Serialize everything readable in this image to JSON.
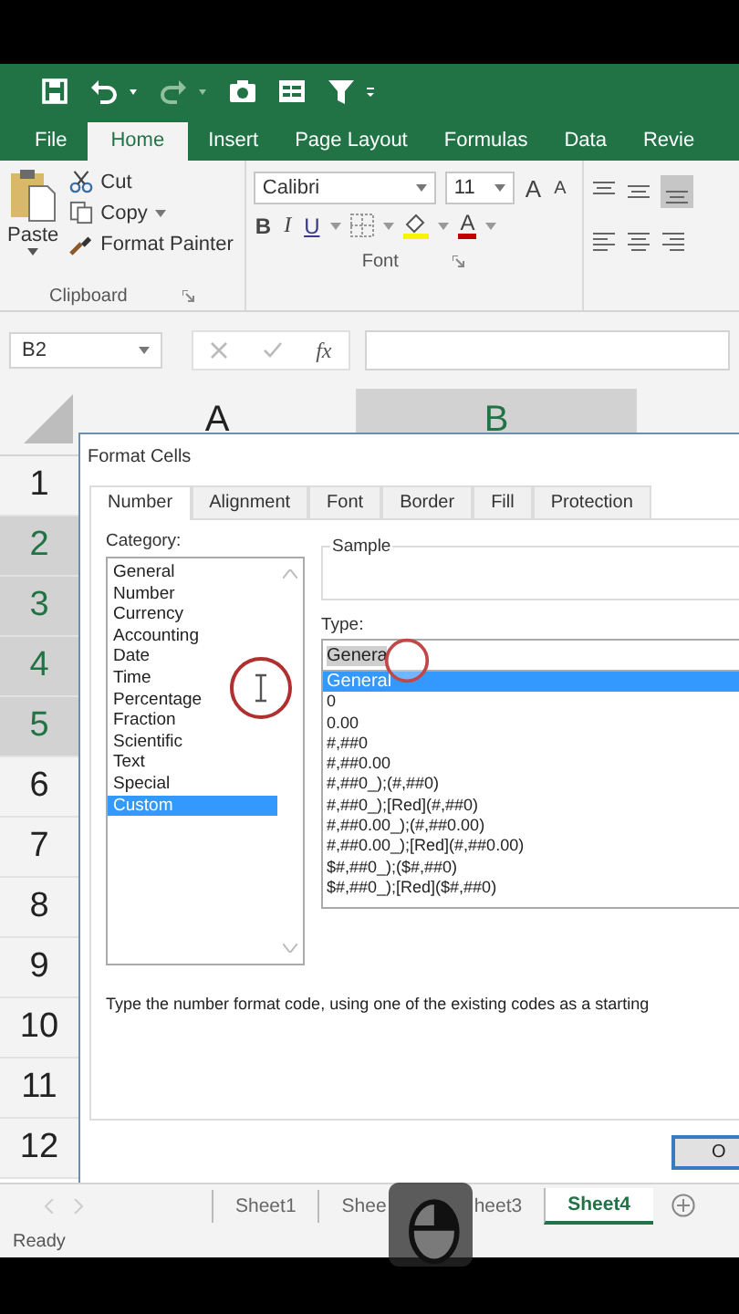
{
  "ribbon_tabs": [
    {
      "label": "File",
      "selected": false
    },
    {
      "label": "Home",
      "selected": true
    },
    {
      "label": "Insert",
      "selected": false
    },
    {
      "label": "Page Layout",
      "selected": false
    },
    {
      "label": "Formulas",
      "selected": false
    },
    {
      "label": "Data",
      "selected": false
    },
    {
      "label": "Revie",
      "selected": false
    }
  ],
  "clipboard": {
    "paste": "Paste",
    "cut": "Cut",
    "copy": "Copy",
    "format_painter": "Format Painter",
    "group_label": "Clipboard"
  },
  "font": {
    "name": "Calibri",
    "size": "11",
    "grow": "A",
    "shrink": "A",
    "bold": "B",
    "italic": "I",
    "underline": "U",
    "font_color_letter": "A",
    "group_label": "Font"
  },
  "name_box": "B2",
  "function_label": "fx",
  "columns": [
    {
      "label": "A",
      "selected": false
    },
    {
      "label": "B",
      "selected": true
    }
  ],
  "rows": [
    {
      "label": "1",
      "selected": false
    },
    {
      "label": "2",
      "selected": true
    },
    {
      "label": "3",
      "selected": true
    },
    {
      "label": "4",
      "selected": true
    },
    {
      "label": "5",
      "selected": true
    },
    {
      "label": "6",
      "selected": false
    },
    {
      "label": "7",
      "selected": false
    },
    {
      "label": "8",
      "selected": false
    },
    {
      "label": "9",
      "selected": false
    },
    {
      "label": "10",
      "selected": false
    },
    {
      "label": "11",
      "selected": false
    },
    {
      "label": "12",
      "selected": false
    }
  ],
  "dialog": {
    "title": "Format Cells",
    "tabs": [
      {
        "label": "Number",
        "selected": true
      },
      {
        "label": "Alignment",
        "selected": false
      },
      {
        "label": "Font",
        "selected": false
      },
      {
        "label": "Border",
        "selected": false
      },
      {
        "label": "Fill",
        "selected": false
      },
      {
        "label": "Protection",
        "selected": false
      }
    ],
    "category_label": "Category:",
    "categories": [
      {
        "label": "General",
        "selected": false
      },
      {
        "label": "Number",
        "selected": false
      },
      {
        "label": "Currency",
        "selected": false
      },
      {
        "label": "Accounting",
        "selected": false
      },
      {
        "label": "Date",
        "selected": false
      },
      {
        "label": "Time",
        "selected": false
      },
      {
        "label": "Percentage",
        "selected": false
      },
      {
        "label": "Fraction",
        "selected": false
      },
      {
        "label": "Scientific",
        "selected": false
      },
      {
        "label": "Text",
        "selected": false
      },
      {
        "label": "Special",
        "selected": false
      },
      {
        "label": "Custom",
        "selected": true
      }
    ],
    "sample_label": "Sample",
    "type_label": "Type:",
    "type_value": "Genera",
    "types": [
      {
        "label": "General",
        "selected": true
      },
      {
        "label": "0",
        "selected": false
      },
      {
        "label": "0.00",
        "selected": false
      },
      {
        "label": "#,##0",
        "selected": false
      },
      {
        "label": "#,##0.00",
        "selected": false
      },
      {
        "label": "#,##0_);(#,##0)",
        "selected": false
      },
      {
        "label": "#,##0_);[Red](#,##0)",
        "selected": false
      },
      {
        "label": "#,##0.00_);(#,##0.00)",
        "selected": false
      },
      {
        "label": "#,##0.00_);[Red](#,##0.00)",
        "selected": false
      },
      {
        "label": "$#,##0_);($#,##0)",
        "selected": false
      },
      {
        "label": "$#,##0_);[Red]($#,##0)",
        "selected": false
      }
    ],
    "description": "Type the number format code, using one of the existing codes as a starting",
    "ok_button": "O"
  },
  "sheet_tabs": [
    {
      "label": "Sheet1",
      "selected": false
    },
    {
      "label": "Shee",
      "selected": false
    },
    {
      "label": "heet3",
      "selected": false
    },
    {
      "label": "Sheet4",
      "selected": true
    }
  ],
  "status": "Ready"
}
